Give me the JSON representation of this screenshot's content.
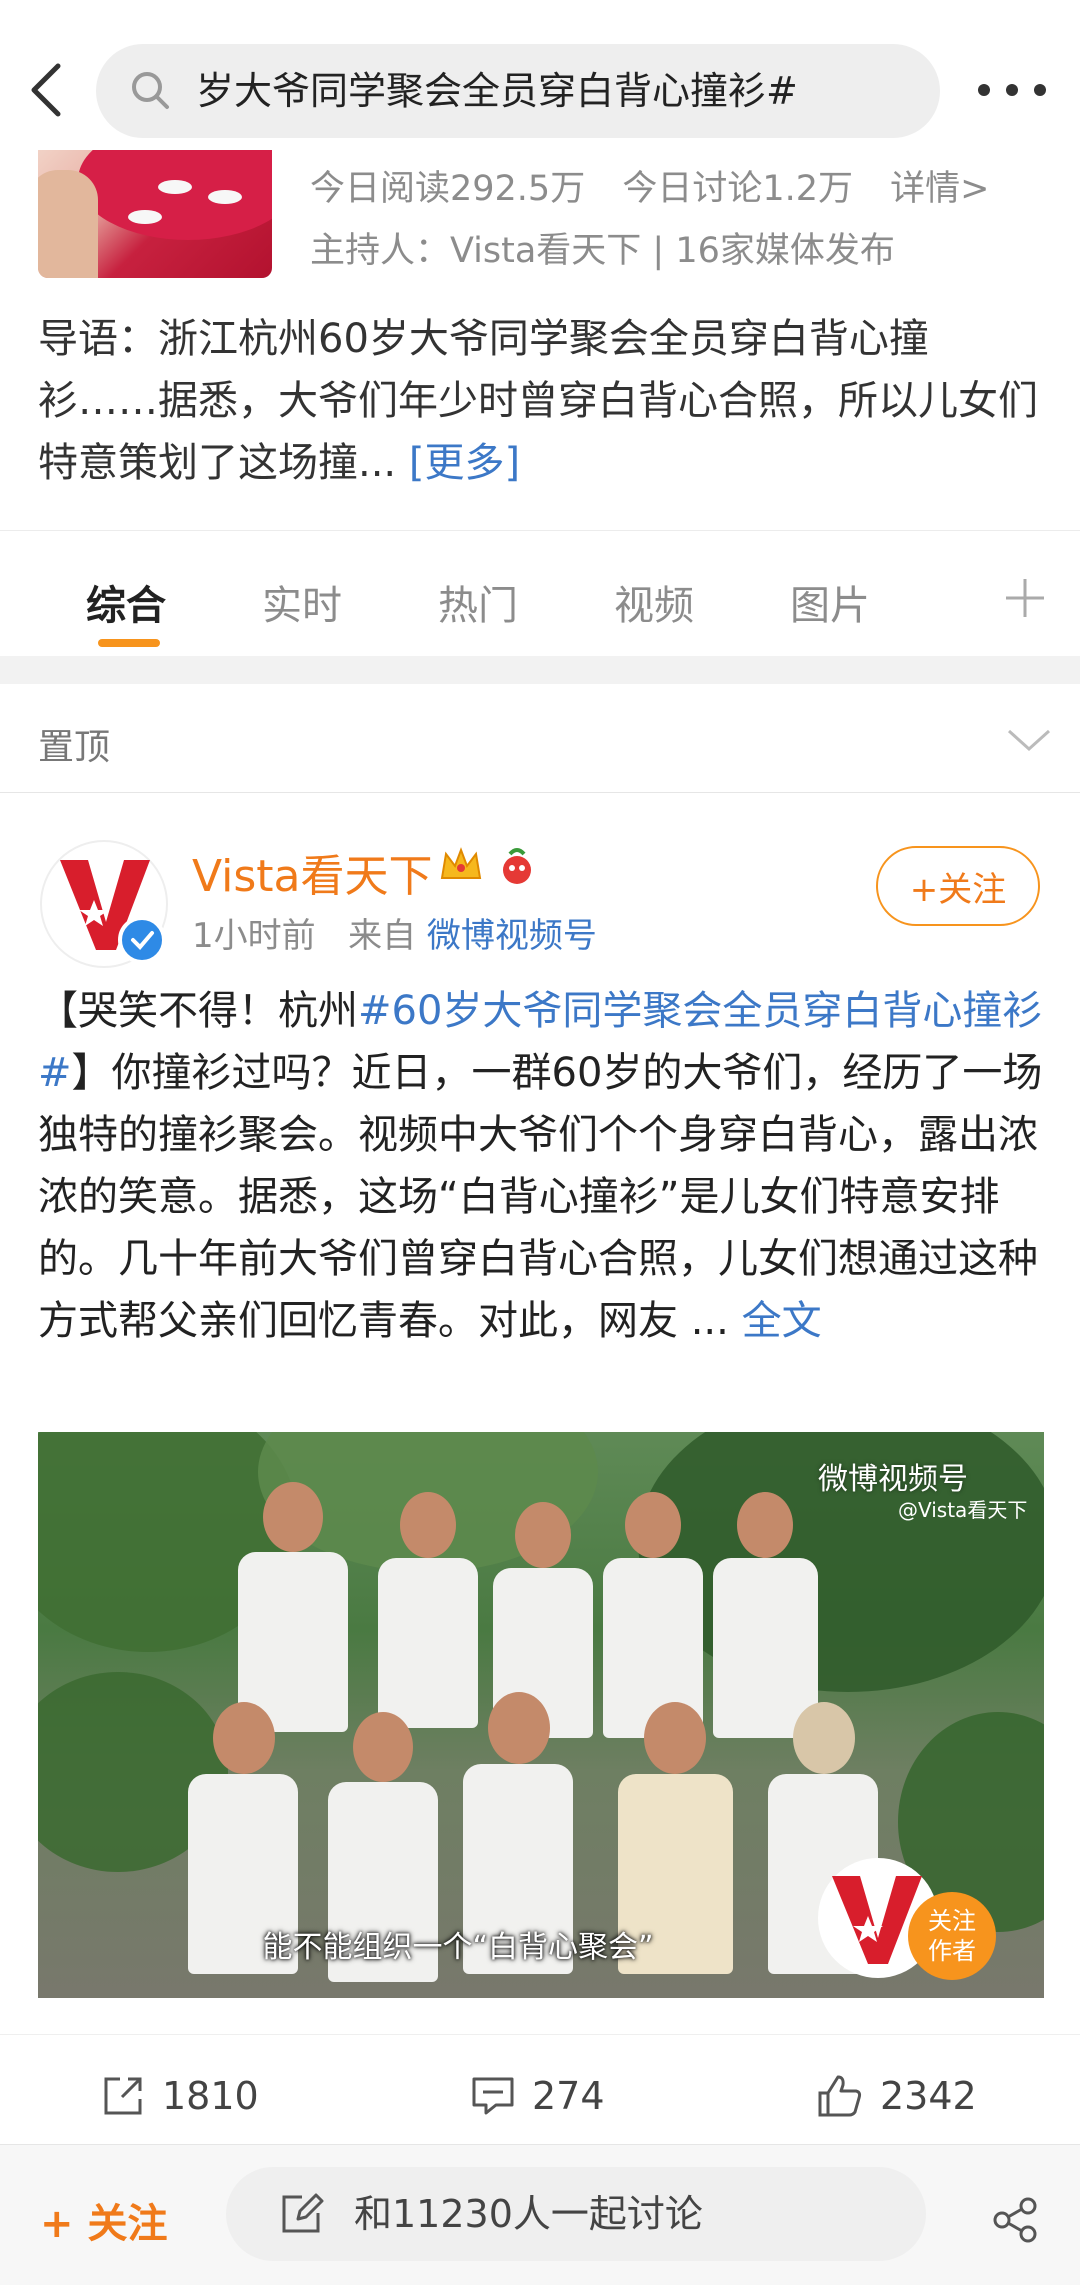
{
  "search": {
    "query": "岁大爷同学聚会全员穿白背心撞衫#"
  },
  "topic": {
    "read_today": "今日阅读292.5万",
    "discuss_today": "今日讨论1.2万",
    "detail_link": "详情>",
    "host_line": "主持人：Vista看天下 | 16家媒体发布",
    "intro": "导语：浙江杭州60岁大爷同学聚会全员穿白背心撞衫……据悉，大爷们年少时曾穿白背心合照，所以儿女们特意策划了这场撞...",
    "intro_more": "[更多]"
  },
  "tabs": [
    "综合",
    "实时",
    "热门",
    "视频",
    "图片"
  ],
  "active_tab": "综合",
  "pinned": {
    "label": "置顶"
  },
  "post": {
    "author": "Vista看天下",
    "time": "1小时前",
    "from_label": "来自",
    "source": "微博视频号",
    "follow_label": "+关注",
    "body_prefix": "【哭笑不得！杭州",
    "hashtag": "#60岁大爷同学聚会全员穿白背心撞衫#",
    "body_rest": "】你撞衫过吗？近日，一群60岁的大爷们，经历了一场独特的撞衫聚会。视频中大爷们个个身穿白背心，露出浓浓的笑意。据悉，这场“白背心撞衫”是儿女们特意安排的。几十年前大爷们曾穿白背心合照，儿女们想通过这种方式帮父亲们回忆青春。对此，网友 ... ",
    "full_text_link": "全文",
    "video": {
      "watermark": "微博视频号",
      "watermark_sub": "@Vista看天下",
      "caption": "能不能组织一个“白背心聚会”",
      "follow_author_line1": "关注",
      "follow_author_line2": "作者"
    },
    "reposts": "1810",
    "comments": "274",
    "likes": "2342"
  },
  "bottom_bar": {
    "follow": "+ 关注",
    "discuss": "和11230人一起讨论"
  },
  "colors": {
    "accent": "#f7941d",
    "link": "#3c78c7",
    "brand_red": "#d81e2c"
  }
}
